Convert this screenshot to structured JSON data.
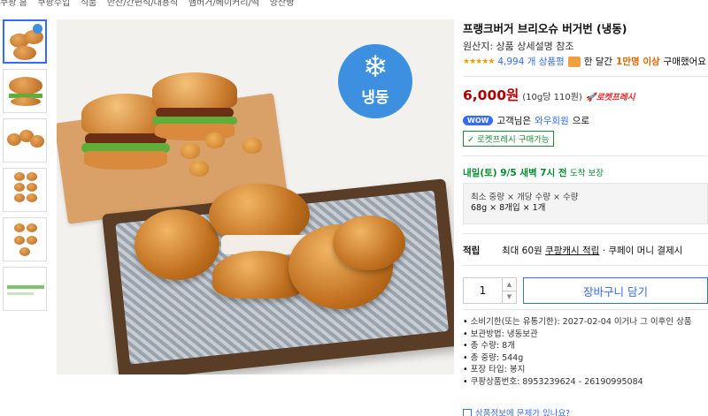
{
  "breadcrumb": [
    "쿠팡 홈",
    "쿠팡수입",
    "식품",
    "반찬/간편식/대용식",
    "햄버거/베이커리/떡",
    "양산빵"
  ],
  "product": {
    "title": "프랭크버거 브리오슈 버거번 (냉동)",
    "origin": "원산지: 상품 상세설명 참조",
    "stars": "★★★★★",
    "review_count": "4,994 개 상품평",
    "buy_prefix": "한 달간",
    "buy_highlight": "1만명 이상",
    "buy_suffix": "구매했어요",
    "price": "6,000원",
    "unit_price": "(10g당 110원)",
    "rocket_label": "로켓프레시",
    "frozen_badge": "냉동"
  },
  "membership": {
    "wow_badge": "WOW",
    "text_before": "고객님은",
    "link": "와우회원",
    "text_after": "으로",
    "rocket_badge": "✓ 로켓프레시 구매가능"
  },
  "delivery": {
    "date": "내일(토) 9/5 새벽 7시 전",
    "guarantee": "도착 보장"
  },
  "spec": {
    "label": "최소 중량 × 개당 수량 × 수량",
    "value": "68g × 8개입 × 1개"
  },
  "cash": {
    "label": "적립",
    "prefix": "최대 60원",
    "link": "쿠팡캐시 적립",
    "suffix": "· 쿠페이 머니 결제시"
  },
  "cart": {
    "quantity": "1",
    "button_label": "장바구니 담기"
  },
  "details": [
    "소비기한(또는 유통기한): 2027-02-04 이거나 그 이후인 상품",
    "보관방법: 냉동보관",
    "총 수량: 8개",
    "총 중량: 544g",
    "포장 타입: 봉지",
    "쿠팡상품번호: 8953239624 - 26190995084"
  ],
  "report_link": "상품정보에 문제가 있나요?",
  "colors": {
    "accent": "#346aff",
    "price": "#ae0000",
    "delivery": "#008c2e",
    "frozen": "#3d8fe0"
  }
}
